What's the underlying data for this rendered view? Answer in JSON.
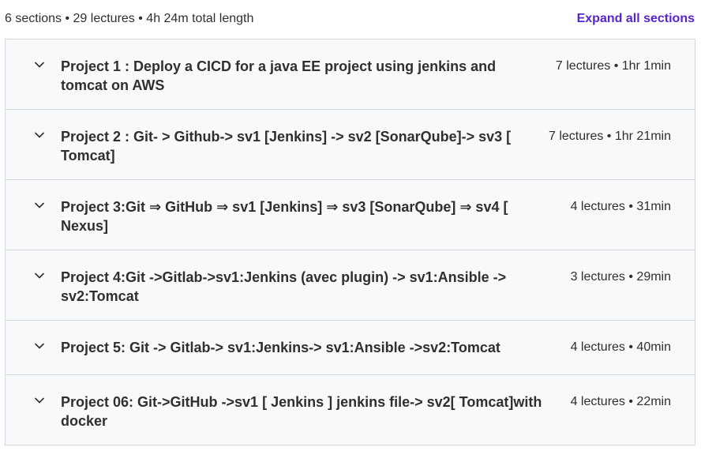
{
  "header": {
    "summary": "6 sections • 29 lectures • 4h 24m total length",
    "expand_all_label": "Expand all sections"
  },
  "sections": [
    {
      "title": "Project 1 : Deploy a CICD for a java EE project using jenkins and tomcat on AWS",
      "meta": "7 lectures • 1hr 1min"
    },
    {
      "title": "Project 2 : Git- > Github-> sv1 [Jenkins] -> sv2 [SonarQube]-> sv3 [ Tomcat]",
      "meta": "7 lectures • 1hr 21min"
    },
    {
      "title": "Project 3:Git ⇒ GitHub ⇒ sv1 [Jenkins] ⇒ sv3 [SonarQube] ⇒ sv4 [ Nexus]",
      "meta": "4 lectures • 31min"
    },
    {
      "title": "Project 4:Git ->Gitlab->sv1:Jenkins (avec plugin) -> sv1:Ansible -> sv2:Tomcat",
      "meta": "3 lectures • 29min"
    },
    {
      "title": "Project 5: Git -> Gitlab-> sv1:Jenkins-> sv1:Ansible ->sv2:Tomcat",
      "meta": "4 lectures • 40min"
    },
    {
      "title": "Project 06: Git->GitHub ->sv1 [ Jenkins ] jenkins file-> sv2[ Tomcat]with docker",
      "meta": "4 lectures • 22min"
    }
  ],
  "icons": {
    "chevron": "chevron-down-icon"
  }
}
